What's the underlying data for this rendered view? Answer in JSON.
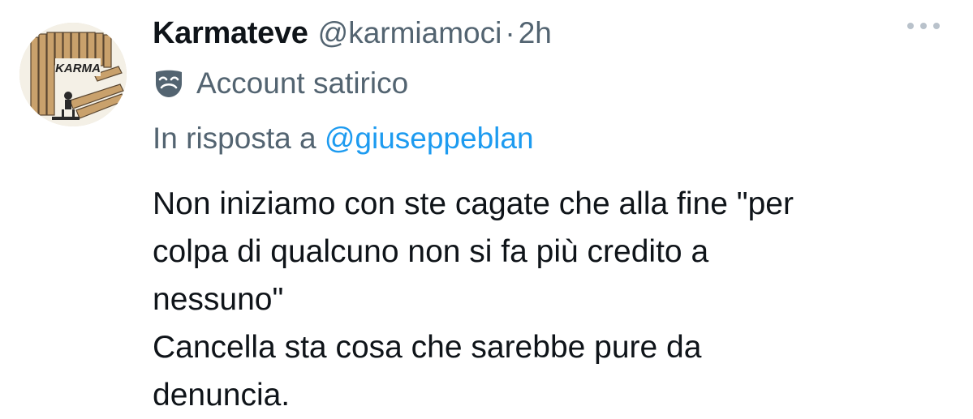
{
  "author": {
    "display_name": "Karmateve",
    "handle": "@karmiamoci",
    "separator": "·",
    "time": "2h",
    "avatar_text": "KARMA"
  },
  "account_label": {
    "icon": "theater-mask-icon",
    "text": "Account satirico"
  },
  "reply": {
    "prefix": "In risposta a",
    "to": "@giuseppeblan"
  },
  "tweet": {
    "lines": [
      "Non iniziamo con ste cagate che alla fine \"per",
      "colpa di qualcuno non si fa più credito a",
      "nessuno\"",
      "Cancella sta cosa che sarebbe pure da",
      "denuncia."
    ]
  },
  "icons": {
    "more": "more-options-icon"
  },
  "colors": {
    "text_primary": "#0f1419",
    "text_secondary": "#536471",
    "link": "#1d9bf0"
  }
}
